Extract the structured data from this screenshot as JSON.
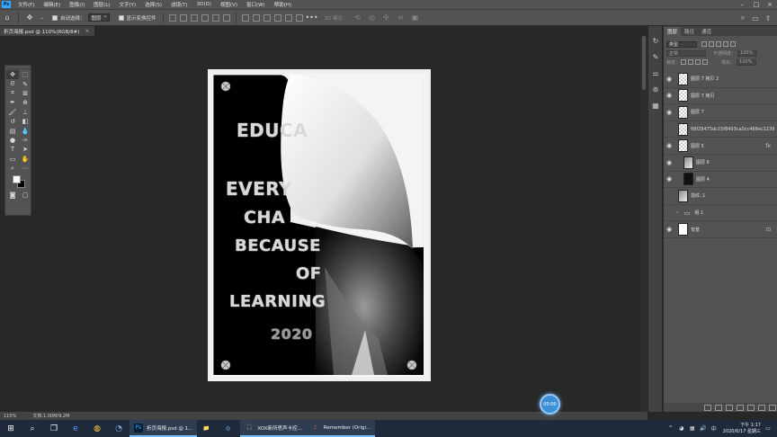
{
  "menubar": {
    "logo": "Ps",
    "items": [
      "文件(F)",
      "编辑(E)",
      "图像(I)",
      "图层(L)",
      "文字(Y)",
      "选择(S)",
      "滤镜(T)",
      "3D(D)",
      "视图(V)",
      "窗口(W)",
      "帮助(H)"
    ]
  },
  "options": {
    "auto_select_label": "自动选择：",
    "auto_select_value": "图层",
    "show_transform_label": "显示变换控件",
    "mode_3d": "3D 模式："
  },
  "document": {
    "tab_title": "折页海报.psd @ 110%(RGB/8#)",
    "poster_lines": [
      "EDUCA",
      "EVERY",
      "CHA",
      "BECAUSE",
      "OF",
      "LEARNING",
      "2020"
    ]
  },
  "layers_panel": {
    "tabs": [
      "图层",
      "路径",
      "通道"
    ],
    "kind_label": "类型",
    "blend_mode": "正常",
    "opacity_label": "不透明度：",
    "opacity_value": "100%",
    "lock_label": "锁定：",
    "fill_label": "填充：",
    "fill_value": "100%",
    "layers": [
      {
        "name": "图层 7 拷贝 2",
        "thumb": "checker",
        "visible": true
      },
      {
        "name": "图层 7 拷贝",
        "thumb": "checker",
        "visible": true
      },
      {
        "name": "图层 7",
        "thumb": "checker",
        "visible": true
      },
      {
        "name": "68f29475dc15f8493ca0cc468ec1239",
        "thumb": "checker",
        "visible": false
      },
      {
        "name": "图层 5",
        "thumb": "checker",
        "visible": true,
        "suffix": "fx"
      },
      {
        "name": "图层 6",
        "thumb": "grey",
        "visible": true
      },
      {
        "name": "图层 4",
        "thumb": "dark",
        "visible": true
      },
      {
        "name": "指纹..1",
        "thumb": "grey",
        "visible": false
      },
      {
        "name": "组 1",
        "thumb": "folder",
        "visible": false
      },
      {
        "name": "背景",
        "thumb": "white",
        "visible": true,
        "suffix": "🔒"
      }
    ]
  },
  "statusbar": {
    "zoom": "110%",
    "doc_info": "文档:1.00M/9.2M"
  },
  "float_badge": "00:00",
  "taskbar": {
    "apps": [
      {
        "label": "折页海报.psd @ 1...",
        "icon": "Ps",
        "open": true
      },
      {
        "label": "",
        "icon": "📁",
        "open": false
      },
      {
        "label": "",
        "icon": "◎",
        "open": false
      },
      {
        "label": "XOX新所思声卡控...",
        "icon": "🎧",
        "open": true
      },
      {
        "label": "Remember (Origi...",
        "icon": "♪",
        "open": true
      }
    ],
    "time": "下午 1:17",
    "date": "2020/6/17 星期三"
  }
}
